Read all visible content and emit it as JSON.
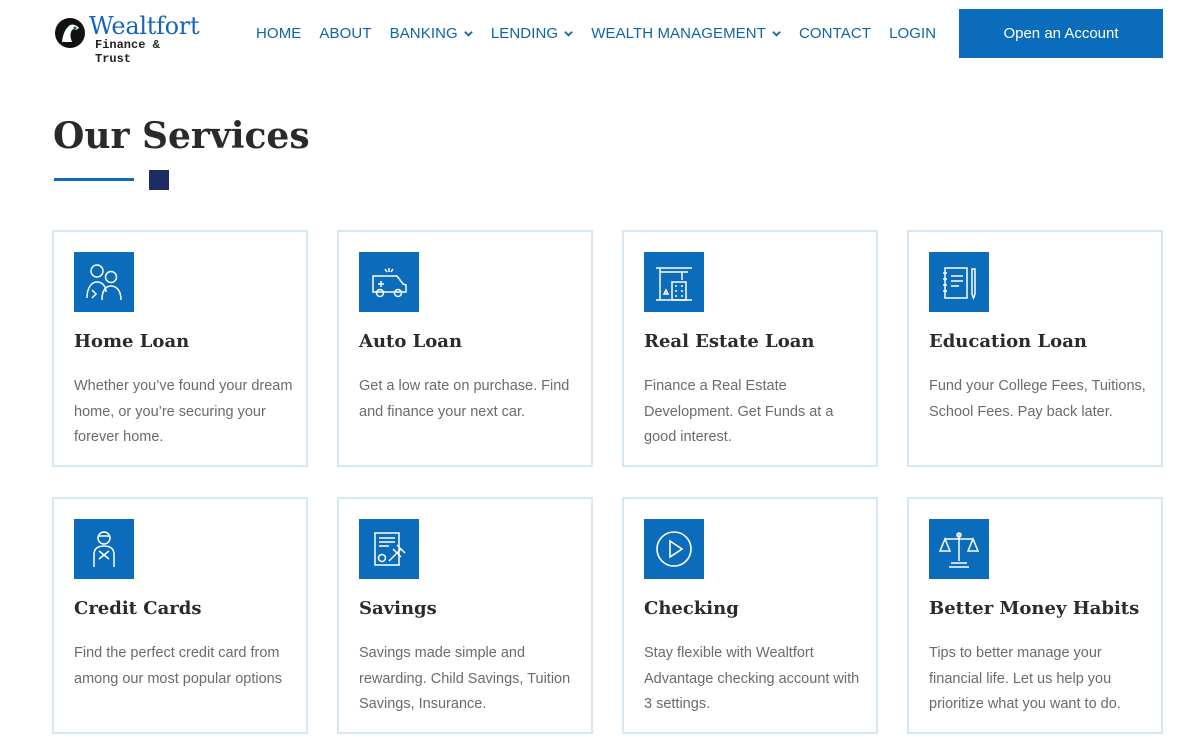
{
  "logo": {
    "brand": "Wealtfort",
    "tagline": "Finance & Trust"
  },
  "nav": {
    "items": [
      {
        "label": "HOME",
        "dropdown": false
      },
      {
        "label": "ABOUT",
        "dropdown": false
      },
      {
        "label": "BANKING",
        "dropdown": true
      },
      {
        "label": "LENDING",
        "dropdown": true
      },
      {
        "label": "WEALTH MANAGEMENT",
        "dropdown": true
      },
      {
        "label": "CONTACT",
        "dropdown": false
      },
      {
        "label": "LOGIN",
        "dropdown": false
      }
    ],
    "cta_label": "Open an Account"
  },
  "section": {
    "title": "Our Services"
  },
  "services": [
    {
      "title": "Home Loan",
      "description": "Whether you’ve found your dream home, or you’re securing your forever home.",
      "icon": "family-icon"
    },
    {
      "title": "Auto Loan",
      "description": "Get a low rate on purchase. Find and finance your next car.",
      "icon": "car-icon"
    },
    {
      "title": "Real Estate Loan",
      "description": "Finance a Real Estate Development. Get Funds at a good interest.",
      "icon": "construction-crane-icon"
    },
    {
      "title": "Education Loan",
      "description": "Fund your College Fees, Tuitions, School Fees. Pay back later.",
      "icon": "notebook-pencil-icon"
    },
    {
      "title": "Credit Cards",
      "description": "Find the perfect credit card from among our most popular options",
      "icon": "person-icon"
    },
    {
      "title": "Savings",
      "description": "Savings made simple and rewarding. Child Savings, Tuition Savings, Insurance.",
      "icon": "document-gavel-icon"
    },
    {
      "title": "Checking",
      "description": "Stay flexible with Wealtfort Advantage checking account with 3 settings.",
      "icon": "play-circle-icon"
    },
    {
      "title": "Better Money Habits",
      "description": "Tips to better manage your financial life. Let us help you prioritize what you want to do.",
      "icon": "scales-icon"
    }
  ],
  "colors": {
    "accent": "#0a6cbb",
    "navy": "#1c2d63",
    "card_border": "#d8e8f2",
    "nav_text": "#0f63aa"
  }
}
